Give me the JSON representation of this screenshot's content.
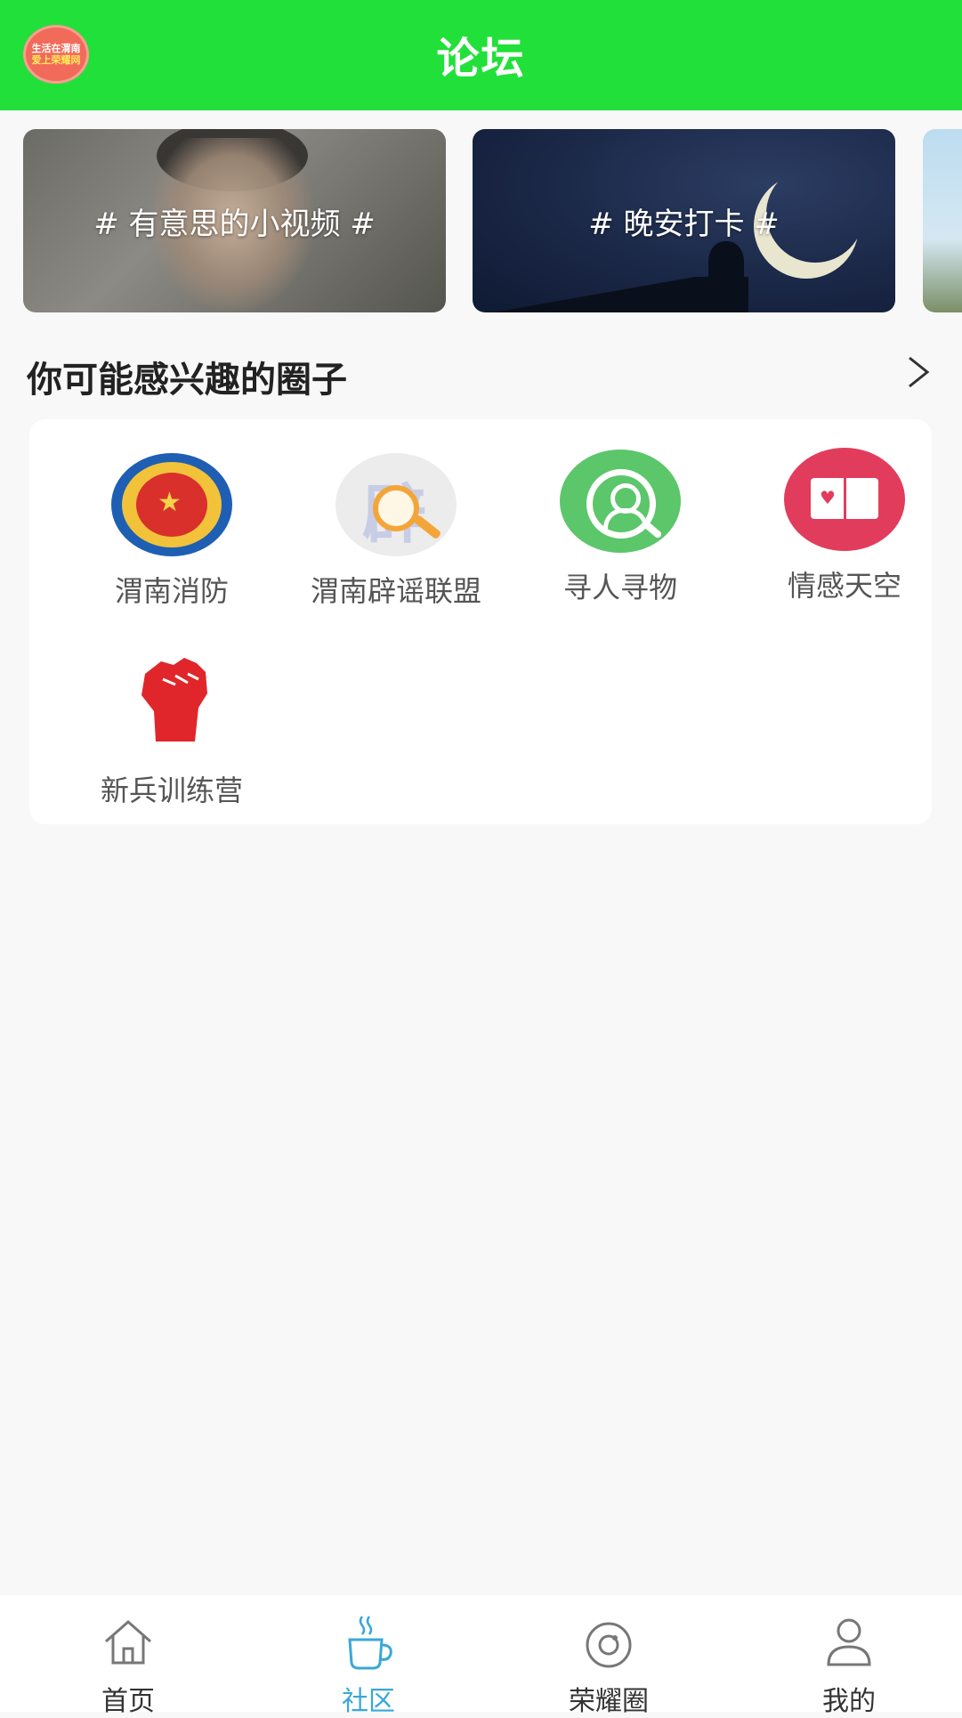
{
  "header": {
    "title": "论坛",
    "logo_lines": [
      "生活在渭南",
      "爱上荣耀网"
    ],
    "accent_color": "#22e03a"
  },
  "banners": [
    {
      "label": "# 有意思的小视频 #"
    },
    {
      "label": "# 晚安打卡 #"
    },
    {
      "label": ""
    }
  ],
  "section": {
    "title": "你可能感兴趣的圈子"
  },
  "circles": [
    {
      "label": "渭南消防",
      "icon": "fire-rescue-emblem-icon"
    },
    {
      "label": "渭南辟谣联盟",
      "icon": "rumor-magnifier-icon"
    },
    {
      "label": "寻人寻物",
      "icon": "person-search-icon"
    },
    {
      "label": "情感天空",
      "icon": "heart-book-icon"
    },
    {
      "label": "新兵训练营",
      "icon": "raised-fist-icon"
    }
  ],
  "bottom_nav": {
    "active_color": "#38a8d8",
    "items": [
      {
        "label": "首页",
        "icon": "home-icon"
      },
      {
        "label": "社区",
        "icon": "coffee-cup-icon"
      },
      {
        "label": "荣耀圈",
        "icon": "circle-ring-icon"
      },
      {
        "label": "我的",
        "icon": "user-icon"
      }
    ]
  }
}
